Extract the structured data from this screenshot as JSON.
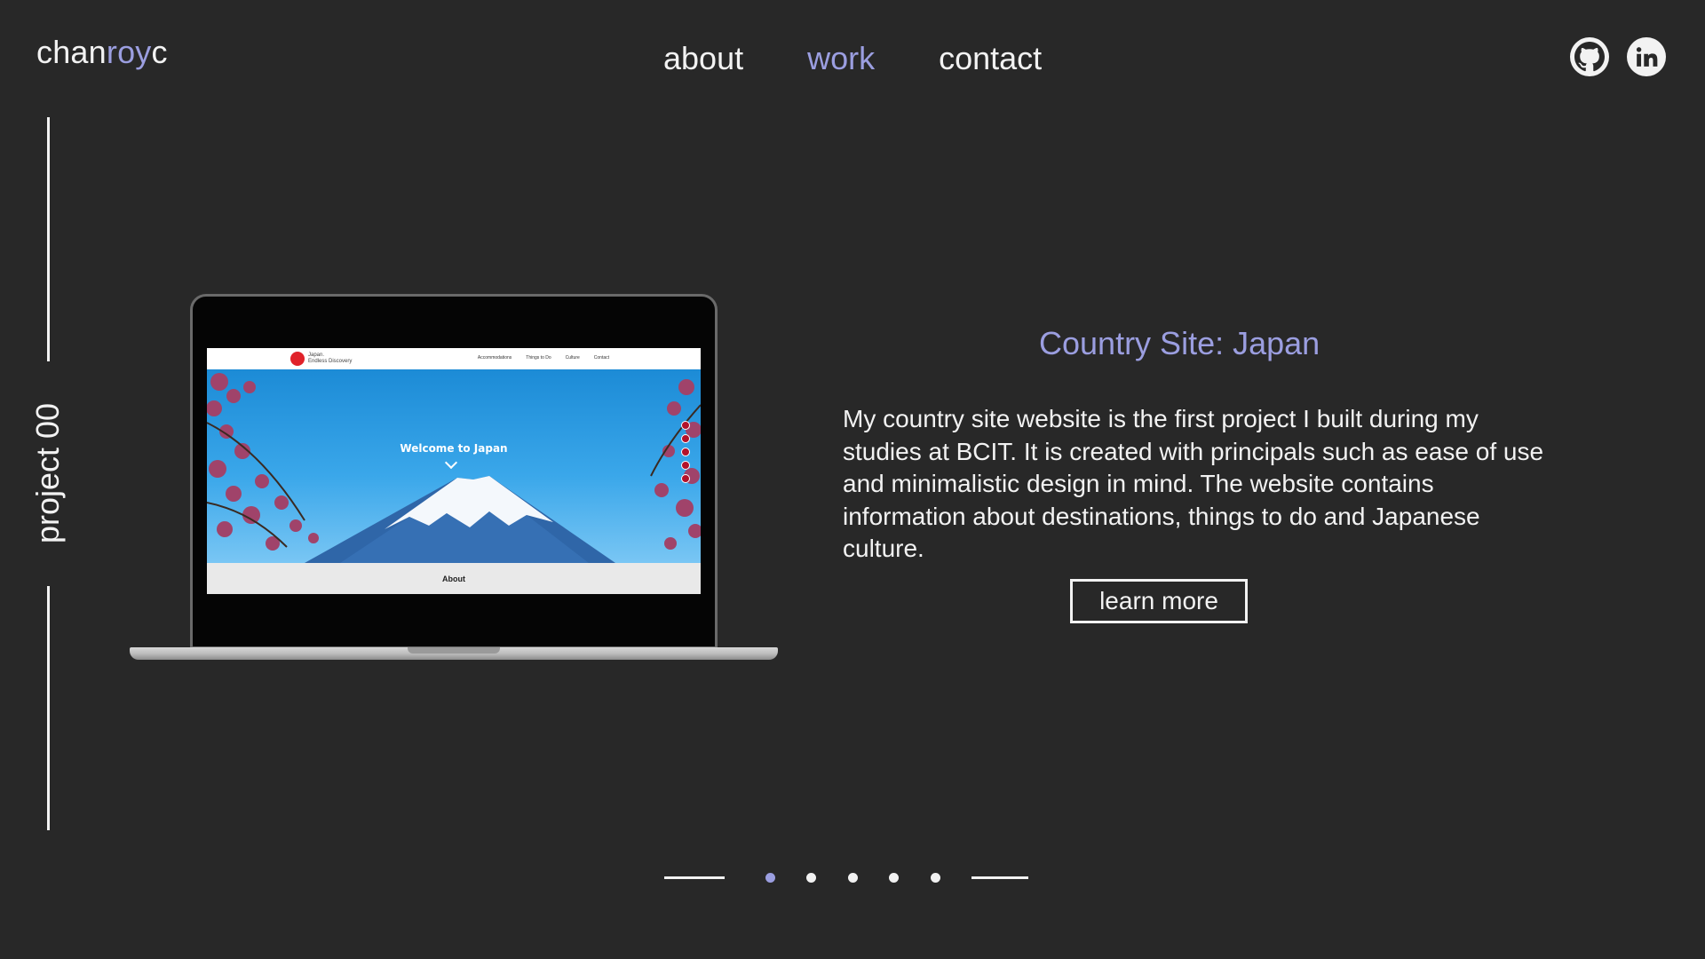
{
  "logo": {
    "part1": "chan",
    "part2": "roy",
    "part3": "c"
  },
  "nav": {
    "items": [
      "about",
      "work",
      "contact"
    ],
    "active": "work"
  },
  "social": [
    {
      "name": "github",
      "icon": "github-icon"
    },
    {
      "name": "linkedin",
      "icon": "linkedin-icon"
    }
  ],
  "project_label": "project 00",
  "preview": {
    "brand": "Japan.",
    "brand_sub": "Endless Discovery",
    "nav_links": [
      "Accommodations",
      "Things to Do",
      "Culture",
      "Contact"
    ],
    "hero_title": "Welcome to Japan",
    "about_label": "About"
  },
  "project": {
    "title": "Country Site: Japan",
    "description": "My country site website is the first project I built during my studies at BCIT. It is created with principals such as ease of use and minimalistic design in mind. The website contains information about destinations, things to do and Japanese culture.",
    "button_label": "learn more"
  },
  "pager": {
    "count": 5,
    "active_index": 0
  },
  "colors": {
    "background": "#282828",
    "accent": "#9b9ee0",
    "text": "#f2f2f2"
  }
}
